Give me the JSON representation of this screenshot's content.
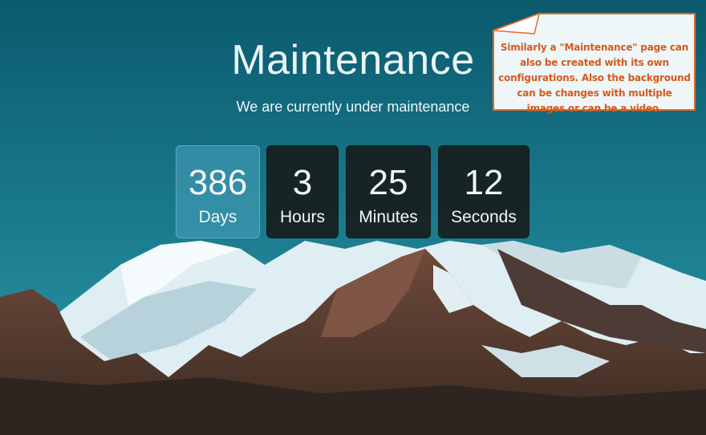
{
  "page": {
    "title": "Maintenance",
    "subtitle": "We are currently under maintenance"
  },
  "countdown": {
    "days": {
      "value": "386",
      "label": "Days"
    },
    "hours": {
      "value": "3",
      "label": "Hours"
    },
    "minutes": {
      "value": "25",
      "label": "Minutes"
    },
    "seconds": {
      "value": "12",
      "label": "Seconds"
    }
  },
  "annotation": {
    "text": "Similarly a \"Maintenance\" page can also be created with its own configurations. Also the background can be changes with multiple images or can be a video."
  },
  "colors": {
    "sky_top": "#0b5a6d",
    "sky_bottom": "#2b98a8",
    "countdown_box": "#181e1e",
    "countdown_active": "#3c96af",
    "note_border": "#e06a2a",
    "note_text": "#d45a1e"
  }
}
